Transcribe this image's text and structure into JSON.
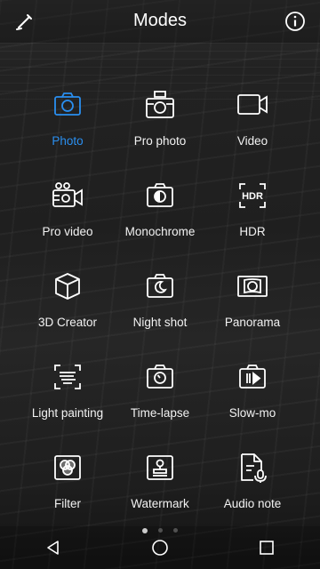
{
  "header": {
    "title": "Modes",
    "edit_icon": "pencil-icon",
    "info_icon": "info-icon"
  },
  "accent_color": "#2a8ff0",
  "modes": [
    {
      "label": "Photo",
      "icon": "camera-icon",
      "active": true
    },
    {
      "label": "Pro photo",
      "icon": "pro-camera-icon"
    },
    {
      "label": "Video",
      "icon": "video-camera-icon"
    },
    {
      "label": "Pro video",
      "icon": "pro-video-icon"
    },
    {
      "label": "Monochrome",
      "icon": "monochrome-icon"
    },
    {
      "label": "HDR",
      "icon": "hdr-icon",
      "icon_text": "HDR"
    },
    {
      "label": "3D Creator",
      "icon": "cube-icon"
    },
    {
      "label": "Night shot",
      "icon": "night-shot-icon"
    },
    {
      "label": "Panorama",
      "icon": "panorama-icon"
    },
    {
      "label": "Light painting",
      "icon": "light-painting-icon"
    },
    {
      "label": "Time-lapse",
      "icon": "time-lapse-icon"
    },
    {
      "label": "Slow-mo",
      "icon": "slow-mo-icon"
    },
    {
      "label": "Filter",
      "icon": "filter-icon"
    },
    {
      "label": "Watermark",
      "icon": "watermark-icon"
    },
    {
      "label": "Audio note",
      "icon": "audio-note-icon"
    }
  ],
  "pager": {
    "pages": 3,
    "current": 1
  },
  "navbar": {
    "back_icon": "back-triangle-icon",
    "home_icon": "home-circle-icon",
    "recents_icon": "recents-square-icon"
  }
}
